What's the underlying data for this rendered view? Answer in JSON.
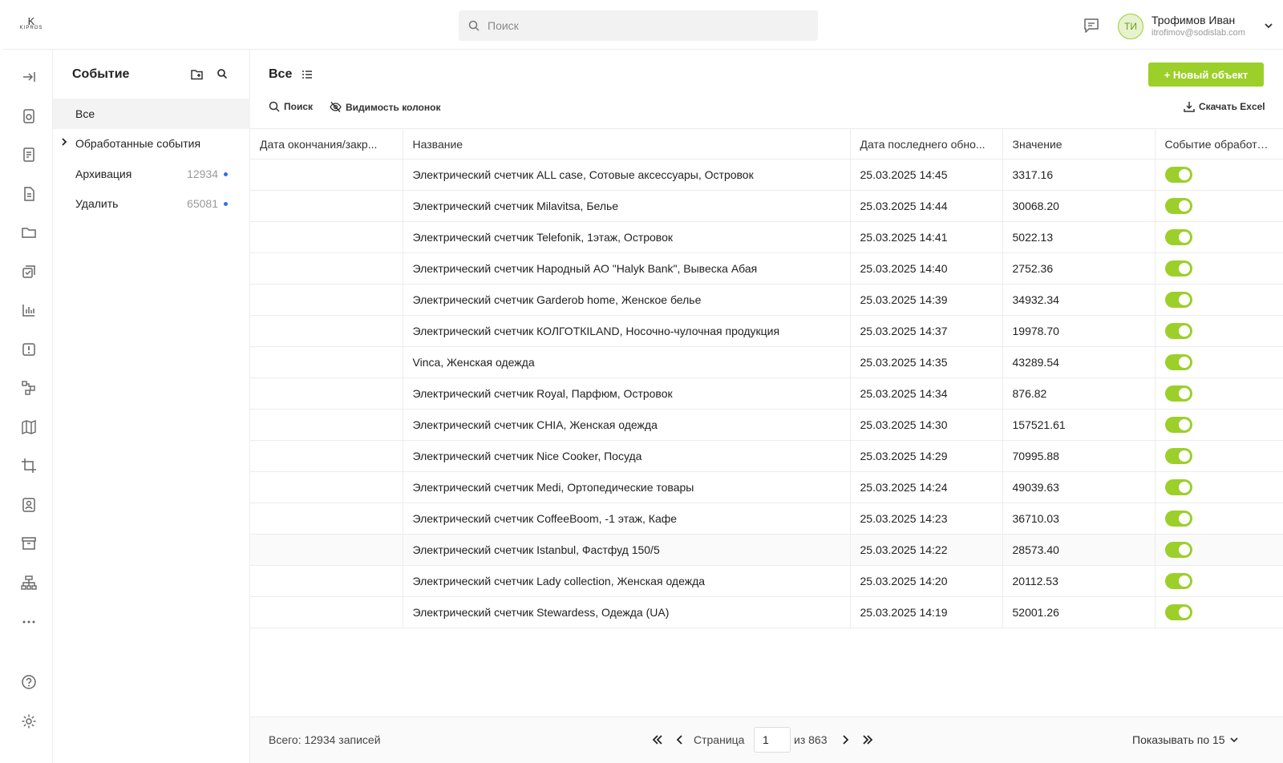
{
  "app": {
    "logo_mark": "K",
    "logo_word": "KIPROS"
  },
  "header": {
    "search_placeholder": "Поиск",
    "user": {
      "initials": "ТИ",
      "name": "Трофимов Иван",
      "email": "itrofimov@sodislab.com"
    }
  },
  "rail": {
    "icons": [
      "collapse-icon",
      "device-icon",
      "form-icon",
      "document-icon",
      "folder-icon",
      "tasks-icon",
      "chart-icon",
      "alert-icon",
      "nodes-icon",
      "map-icon",
      "crop-icon",
      "contact-icon",
      "archive-icon",
      "hierarchy-icon",
      "more-icon",
      "help-icon",
      "settings-icon"
    ]
  },
  "folders": {
    "title": "Событие",
    "items": [
      {
        "label": "Все",
        "count": ""
      },
      {
        "label": "Обработанные события",
        "count": ""
      },
      {
        "label": "Архивация",
        "count": "12934"
      },
      {
        "label": "Удалить",
        "count": "65081"
      }
    ]
  },
  "view": {
    "title": "Все",
    "new_button": "+ Новый объект",
    "search_label": "Поиск",
    "columns_label": "Видимость колонок",
    "excel_label": "Скачать Excel"
  },
  "table": {
    "headers": [
      "Дата окончания/закр...",
      "Название",
      "Дата последнего обно...",
      "Значение",
      "Событие обработано?"
    ],
    "rows": [
      {
        "end": "",
        "name": "Электрический счетчик ALL case, Сотовые аксессуары, Островок",
        "updated": "25.03.2025 14:45",
        "value": "3317.16",
        "processed": true
      },
      {
        "end": "",
        "name": "Электрический счетчик Milavitsa, Белье",
        "updated": "25.03.2025 14:44",
        "value": "30068.20",
        "processed": true
      },
      {
        "end": "",
        "name": "Электрический счетчик Telefonik, 1этаж, Островок",
        "updated": "25.03.2025 14:41",
        "value": "5022.13",
        "processed": true
      },
      {
        "end": "",
        "name": "Электрический счетчик Народный АО \"Halyk Bank\", Вывеска Абая",
        "updated": "25.03.2025 14:40",
        "value": "2752.36",
        "processed": true
      },
      {
        "end": "",
        "name": "Электрический счетчик Garderob home, Женское белье",
        "updated": "25.03.2025 14:39",
        "value": "34932.34",
        "processed": true
      },
      {
        "end": "",
        "name": "Электрический счетчик КОЛГОТКILAND, Носочно-чулочная продукция",
        "updated": "25.03.2025 14:37",
        "value": "19978.70",
        "processed": true
      },
      {
        "end": "",
        "name": "Vinca, Женская одежда",
        "updated": "25.03.2025 14:35",
        "value": "43289.54",
        "processed": true
      },
      {
        "end": "",
        "name": "Электрический счетчик Royal, Парфюм, Островок",
        "updated": "25.03.2025 14:34",
        "value": "876.82",
        "processed": true
      },
      {
        "end": "",
        "name": "Электрический счетчик CHIA, Женская одежда",
        "updated": "25.03.2025 14:30",
        "value": "157521.61",
        "processed": true
      },
      {
        "end": "",
        "name": "Электрический счетчик Nice Cooker, Посуда",
        "updated": "25.03.2025 14:29",
        "value": "70995.88",
        "processed": true
      },
      {
        "end": "",
        "name": "Электрический счетчик Medi, Ортопедические товары",
        "updated": "25.03.2025 14:24",
        "value": "49039.63",
        "processed": true
      },
      {
        "end": "",
        "name": "Электрический счетчик CoffeeBoom, -1 этаж, Кафе",
        "updated": "25.03.2025 14:23",
        "value": "36710.03",
        "processed": true
      },
      {
        "end": "",
        "name": "Электрический счетчик Istanbul, Фастфуд 150/5",
        "updated": "25.03.2025 14:22",
        "value": "28573.40",
        "processed": true
      },
      {
        "end": "",
        "name": "Электрический счетчик Lady collection, Женская одежда",
        "updated": "25.03.2025 14:20",
        "value": "20112.53",
        "processed": true
      },
      {
        "end": "",
        "name": "Электрический счетчик Stewardess, Одежда (UA)",
        "updated": "25.03.2025 14:19",
        "value": "52001.26",
        "processed": true
      }
    ]
  },
  "footer": {
    "total": "Всего: 12934 записей",
    "page_label": "Страница",
    "page_value": "1",
    "of_label": "из 863",
    "per_page": "Показывать по 15"
  },
  "colors": {
    "accent": "#9ccf2a",
    "dot": "#2f6fe8"
  }
}
